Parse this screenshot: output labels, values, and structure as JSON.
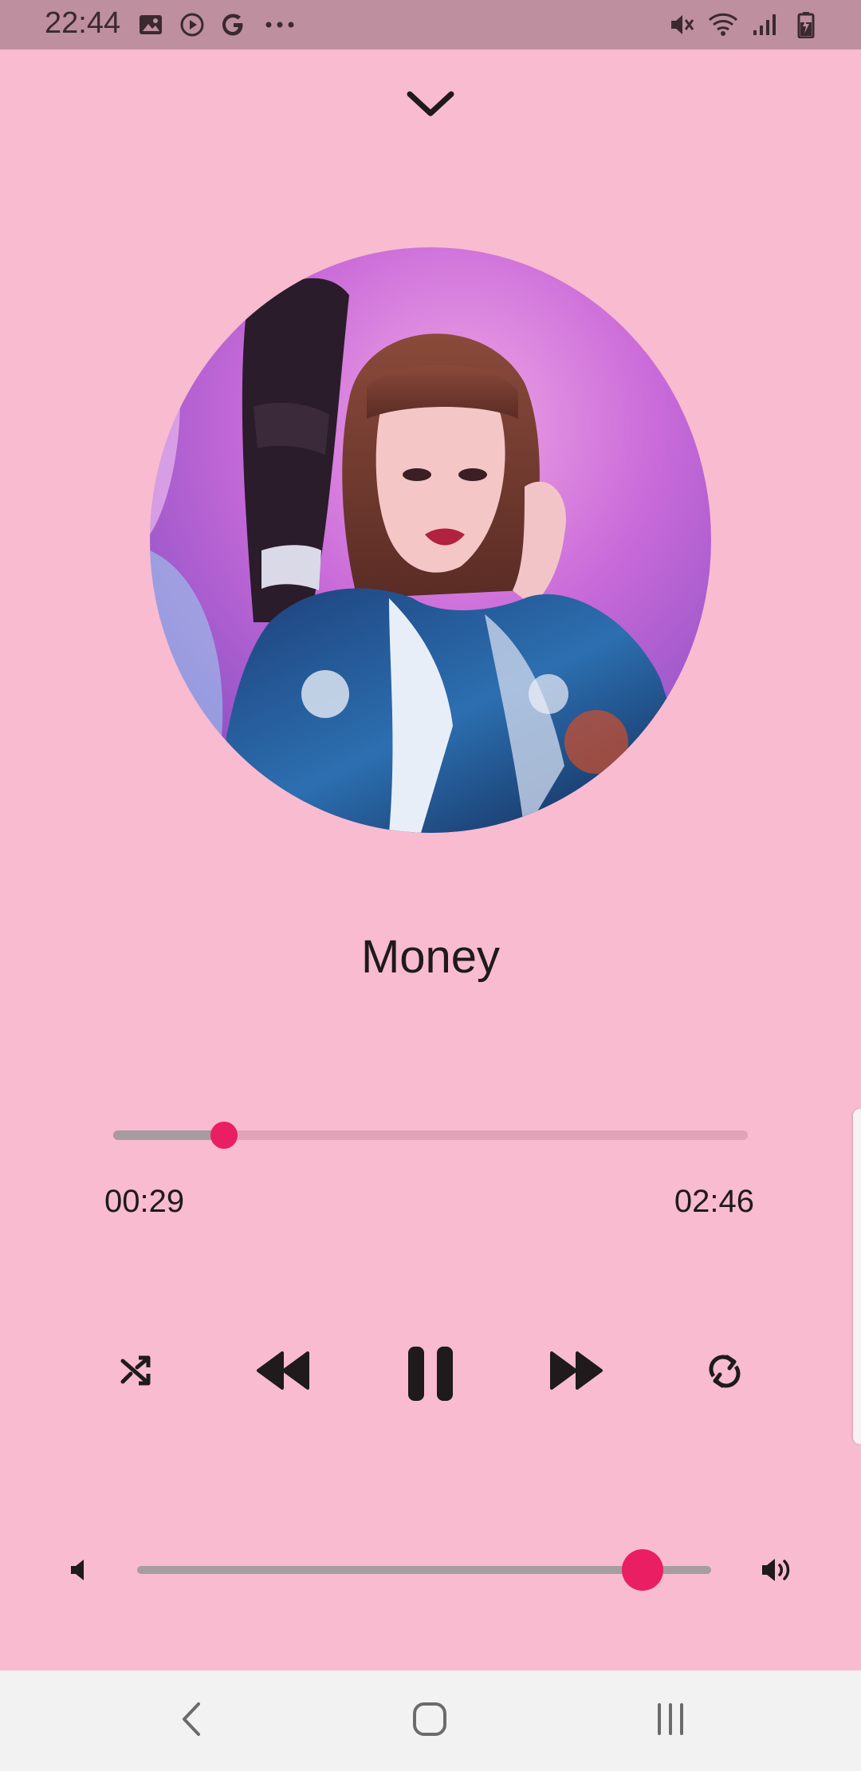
{
  "status_bar": {
    "time": "22:44",
    "left_icons": [
      "gallery-icon",
      "play-circle-icon",
      "google-icon",
      "more-dots-icon"
    ],
    "right_icons": [
      "mute-icon",
      "wifi-icon",
      "signal-icon",
      "battery-charging-icon"
    ]
  },
  "player": {
    "collapse_icon": "chevron-down-icon",
    "song_title": "Money",
    "album_art": "album-art-photo",
    "progress": {
      "current_time": "00:29",
      "duration": "02:46",
      "fraction": 0.175
    },
    "controls": [
      "shuffle-icon",
      "rewind-icon",
      "pause-icon",
      "fast-forward-icon",
      "repeat-icon"
    ],
    "volume": {
      "fraction": 0.88,
      "left_icon": "volume-low-icon",
      "right_icon": "volume-high-icon"
    }
  },
  "colors": {
    "background": "#f8bbd0",
    "status_bar": "#be8f9e",
    "accent": "#e91e63",
    "track": "#e1a3b8",
    "track_fill": "#a79aa0",
    "navbar": "#f2f2f2"
  },
  "nav_bar": [
    "back-icon",
    "home-icon",
    "recent-apps-icon"
  ]
}
